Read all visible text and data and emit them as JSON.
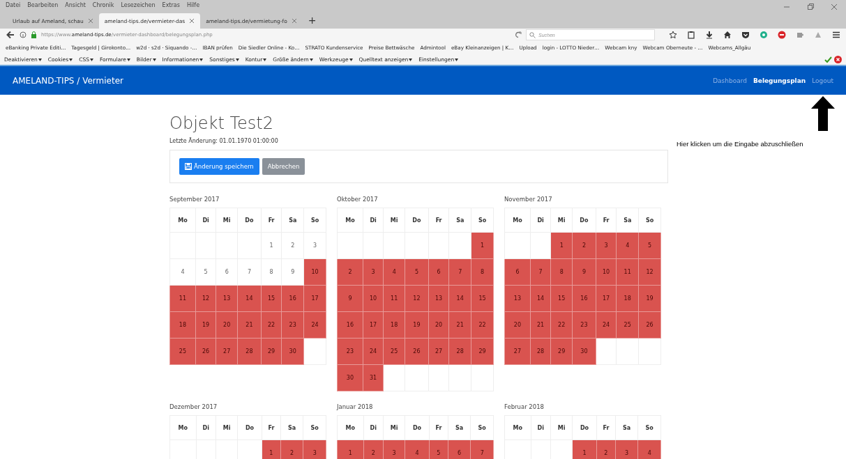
{
  "browser": {
    "menu": [
      "Datei",
      "Bearbeiten",
      "Ansicht",
      "Chronik",
      "Lesezeichen",
      "Extras",
      "Hilfe"
    ],
    "tabs": [
      {
        "title": "Urlaub auf Ameland, schau",
        "selected": false
      },
      {
        "title": "ameland-tips.de/vermieter-das",
        "selected": true
      },
      {
        "title": "ameland-tips.de/vermietung-fo",
        "selected": false
      }
    ],
    "new_tab": "+",
    "url": "https://www.**ameland-tips.de**/vermieter-dashboard/belegungsplan.php",
    "search": {
      "placeholder": "Suchen"
    },
    "bookmarks": [
      "eBanking Private Editi…",
      "Tagesgeld | Girokonto…",
      "w2d · s2d · Siquando -…",
      "IBAN prüfen",
      "Die Siedler Online - Ko…",
      "STRATO Kundenservice",
      "Preise Bettwäsche",
      "Admintool",
      "eBay Kleinanzeigen | K…",
      "Upload",
      "login - LOTTO Nieder…",
      "Webcam kny",
      "Webcam Oberneute - …",
      "Webcams_Allgäu"
    ],
    "devtools": [
      "Deaktivieren",
      "Cookies",
      "CSS",
      "Formulare",
      "Bilder",
      "Informationen",
      "Sonstiges",
      "Kontur",
      "Größe ändern",
      "Werkzeuge",
      "Quelltext anzeigen",
      "Einstellungen"
    ]
  },
  "navbar": {
    "brand": "AMELAND-TIPS / Vermieter",
    "links": [
      {
        "label": "Dashboard",
        "selected": false
      },
      {
        "label": "Belegungsplan",
        "selected": true
      },
      {
        "label": "Logout",
        "selected": false
      }
    ]
  },
  "annotation": "Hier klicken um die Eingabe abzuschließen",
  "page": {
    "title": "Objekt Test2",
    "subtitle": "Letzte Änderung: 01.01.1970 01:00:00",
    "buttons": [
      {
        "label": "Änderung speichern",
        "kind": "primary"
      },
      {
        "label": "Abbrechen",
        "kind": "secondary"
      }
    ]
  },
  "months": [
    {
      "title": "September 2017",
      "weekdays": [
        "Mo",
        "Di",
        "Mi",
        "Do",
        "Fr",
        "Sa",
        "So"
      ],
      "weeks": [
        [
          {
            "booked": false
          },
          {
            "booked": false
          },
          {
            "booked": false
          },
          {
            "booked": false
          },
          {
            "day": "1",
            "booked": false
          },
          {
            "day": "2",
            "booked": false
          },
          {
            "day": "3",
            "booked": false
          }
        ],
        [
          {
            "day": "4",
            "booked": false
          },
          {
            "day": "5",
            "booked": false
          },
          {
            "day": "6",
            "booked": false
          },
          {
            "day": "7",
            "booked": false
          },
          {
            "day": "8",
            "booked": false
          },
          {
            "day": "9",
            "booked": false
          },
          {
            "day": "10",
            "booked": true
          }
        ],
        [
          {
            "day": "11",
            "booked": true
          },
          {
            "day": "12",
            "booked": true
          },
          {
            "day": "13",
            "booked": true
          },
          {
            "day": "14",
            "booked": true
          },
          {
            "day": "15",
            "booked": true
          },
          {
            "day": "16",
            "booked": true
          },
          {
            "day": "17",
            "booked": true
          }
        ],
        [
          {
            "day": "18",
            "booked": true
          },
          {
            "day": "19",
            "booked": true
          },
          {
            "day": "20",
            "booked": true
          },
          {
            "day": "21",
            "booked": true
          },
          {
            "day": "22",
            "booked": true
          },
          {
            "day": "23",
            "booked": true
          },
          {
            "day": "24",
            "booked": true
          }
        ],
        [
          {
            "day": "25",
            "booked": true
          },
          {
            "day": "26",
            "booked": true
          },
          {
            "day": "27",
            "booked": true
          },
          {
            "day": "28",
            "booked": true
          },
          {
            "day": "29",
            "booked": true
          },
          {
            "day": "30",
            "booked": true
          },
          {
            "booked": false
          }
        ]
      ]
    },
    {
      "title": "Oktober 2017",
      "weekdays": [
        "Mo",
        "Di",
        "Mi",
        "Do",
        "Fr",
        "Sa",
        "So"
      ],
      "weeks": [
        [
          {
            "booked": false
          },
          {
            "booked": false
          },
          {
            "booked": false
          },
          {
            "booked": false
          },
          {
            "booked": false
          },
          {
            "booked": false
          },
          {
            "day": "1",
            "booked": true
          }
        ],
        [
          {
            "day": "2",
            "booked": true
          },
          {
            "day": "3",
            "booked": true
          },
          {
            "day": "4",
            "booked": true
          },
          {
            "day": "5",
            "booked": true
          },
          {
            "day": "6",
            "booked": true
          },
          {
            "day": "7",
            "booked": true
          },
          {
            "day": "8",
            "booked": true
          }
        ],
        [
          {
            "day": "9",
            "booked": true
          },
          {
            "day": "10",
            "booked": true
          },
          {
            "day": "11",
            "booked": true
          },
          {
            "day": "12",
            "booked": true
          },
          {
            "day": "13",
            "booked": true
          },
          {
            "day": "14",
            "booked": true
          },
          {
            "day": "15",
            "booked": true
          }
        ],
        [
          {
            "day": "16",
            "booked": true
          },
          {
            "day": "17",
            "booked": true
          },
          {
            "day": "18",
            "booked": true
          },
          {
            "day": "19",
            "booked": true
          },
          {
            "day": "20",
            "booked": true
          },
          {
            "day": "21",
            "booked": true
          },
          {
            "day": "22",
            "booked": true
          }
        ],
        [
          {
            "day": "23",
            "booked": true
          },
          {
            "day": "24",
            "booked": true
          },
          {
            "day": "25",
            "booked": true
          },
          {
            "day": "26",
            "booked": true
          },
          {
            "day": "27",
            "booked": true
          },
          {
            "day": "28",
            "booked": true
          },
          {
            "day": "29",
            "booked": true
          }
        ],
        [
          {
            "day": "30",
            "booked": true
          },
          {
            "day": "31",
            "booked": true
          },
          {
            "booked": false
          },
          {
            "booked": false
          },
          {
            "booked": false
          },
          {
            "booked": false
          },
          {
            "booked": false
          }
        ]
      ]
    },
    {
      "title": "November 2017",
      "weekdays": [
        "Mo",
        "Di",
        "Mi",
        "Do",
        "Fr",
        "Sa",
        "So"
      ],
      "weeks": [
        [
          {
            "booked": false
          },
          {
            "booked": false
          },
          {
            "day": "1",
            "booked": true
          },
          {
            "day": "2",
            "booked": true
          },
          {
            "day": "3",
            "booked": true
          },
          {
            "day": "4",
            "booked": true
          },
          {
            "day": "5",
            "booked": true
          }
        ],
        [
          {
            "day": "6",
            "booked": true
          },
          {
            "day": "7",
            "booked": true
          },
          {
            "day": "8",
            "booked": true
          },
          {
            "day": "9",
            "booked": true
          },
          {
            "day": "10",
            "booked": true
          },
          {
            "day": "11",
            "booked": true
          },
          {
            "day": "12",
            "booked": true
          }
        ],
        [
          {
            "day": "13",
            "booked": true
          },
          {
            "day": "14",
            "booked": true
          },
          {
            "day": "15",
            "booked": true
          },
          {
            "day": "16",
            "booked": true
          },
          {
            "day": "17",
            "booked": true
          },
          {
            "day": "18",
            "booked": true
          },
          {
            "day": "19",
            "booked": true
          }
        ],
        [
          {
            "day": "20",
            "booked": true
          },
          {
            "day": "21",
            "booked": true
          },
          {
            "day": "22",
            "booked": true
          },
          {
            "day": "23",
            "booked": true
          },
          {
            "day": "24",
            "booked": true
          },
          {
            "day": "25",
            "booked": true
          },
          {
            "day": "26",
            "booked": true
          }
        ],
        [
          {
            "day": "27",
            "booked": true
          },
          {
            "day": "28",
            "booked": true
          },
          {
            "day": "29",
            "booked": true
          },
          {
            "day": "30",
            "booked": true
          },
          {
            "booked": false
          },
          {
            "booked": false
          },
          {
            "booked": false
          }
        ]
      ]
    },
    {
      "title": "Dezember 2017",
      "weekdays": [
        "Mo",
        "Di",
        "Mi",
        "Do",
        "Fr",
        "Sa",
        "So"
      ],
      "weeks": [
        [
          {
            "booked": false
          },
          {
            "booked": false
          },
          {
            "booked": false
          },
          {
            "booked": false
          },
          {
            "day": "1",
            "booked": true
          },
          {
            "day": "2",
            "booked": true
          },
          {
            "day": "3",
            "booked": true
          }
        ]
      ]
    },
    {
      "title": "Januar 2018",
      "weekdays": [
        "Mo",
        "Di",
        "Mi",
        "Do",
        "Fr",
        "Sa",
        "So"
      ],
      "weeks": [
        [
          {
            "day": "1",
            "booked": true
          },
          {
            "day": "2",
            "booked": true
          },
          {
            "day": "3",
            "booked": true
          },
          {
            "day": "4",
            "booked": true
          },
          {
            "day": "5",
            "booked": true
          },
          {
            "day": "6",
            "booked": true
          },
          {
            "day": "7",
            "booked": true
          }
        ]
      ]
    },
    {
      "title": "Februar 2018",
      "weekdays": [
        "Mo",
        "Di",
        "Mi",
        "Do",
        "Fr",
        "Sa",
        "So"
      ],
      "weeks": [
        [
          {
            "booked": false
          },
          {
            "booked": false
          },
          {
            "booked": false
          },
          {
            "day": "1",
            "booked": true
          },
          {
            "day": "2",
            "booked": true
          },
          {
            "day": "3",
            "booked": true
          },
          {
            "day": "4",
            "booked": true
          }
        ]
      ]
    }
  ]
}
